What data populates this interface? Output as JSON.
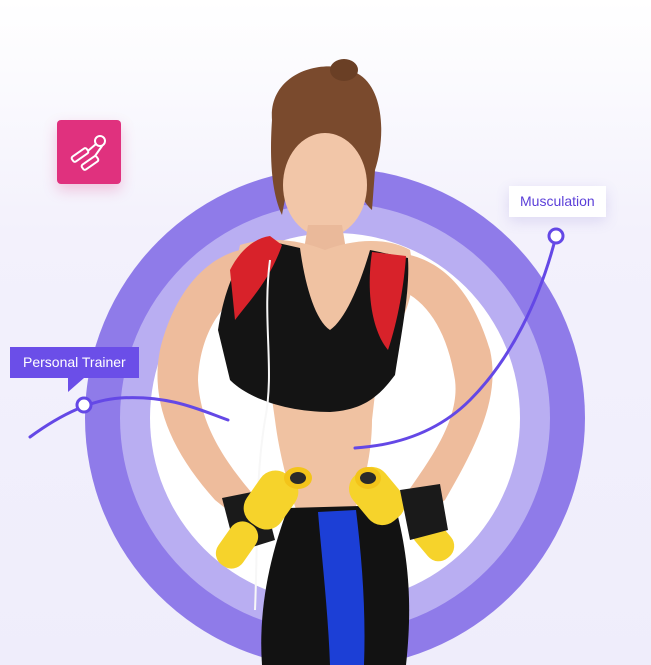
{
  "hero": {
    "badge_icon": "hand-gripper-icon",
    "labels": {
      "personal_trainer": "Personal Trainer",
      "musculation": "Musculation"
    },
    "image": "woman-with-yellow-dumbbells-photo"
  },
  "colors": {
    "ring_outer": "#8f7be9",
    "ring_mid": "#b9aef2",
    "accent_purple": "#6b4ee8",
    "badge_pink": "#e0317e",
    "curve": "#6448e6",
    "dumbbell_yellow": "#f6d32b",
    "pants_blue": "#1c3fd6",
    "top_red": "#d8222a"
  }
}
